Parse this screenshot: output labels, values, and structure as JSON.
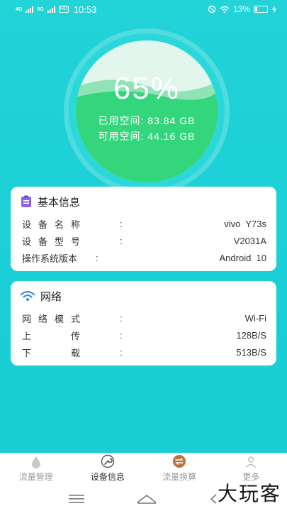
{
  "status_bar": {
    "time": "10:53",
    "signal1": "4G",
    "signal2": "5G",
    "hd": "HD",
    "battery": "13%"
  },
  "storage": {
    "percent": "65%",
    "used": "已用空间: 83.84 GB",
    "free": "可用空间: 44.16 GB",
    "used_fraction": 0.65
  },
  "basic_info": {
    "title": "基本信息",
    "rows": [
      {
        "label": "设备名称",
        "colon": ":",
        "value": "vivo  Y73s"
      },
      {
        "label": "设备型号",
        "colon": ":",
        "value": "V2031A"
      },
      {
        "label": "操作系统版本",
        "colon": ":",
        "value": "Android  10"
      }
    ]
  },
  "network": {
    "title": "网络",
    "rows": [
      {
        "label": "网络模式",
        "colon": ":",
        "value": "Wi-Fi"
      },
      {
        "label": "上传",
        "colon": ":",
        "value": "128B/S"
      },
      {
        "label": "下载",
        "colon": ":",
        "value": "513B/S"
      }
    ]
  },
  "tabs": [
    {
      "label": "流量管理",
      "icon": "drop-icon",
      "active": false
    },
    {
      "label": "设备信息",
      "icon": "wrench-icon",
      "active": true
    },
    {
      "label": "流量换算",
      "icon": "exchange-icon",
      "active": false
    },
    {
      "label": "更多",
      "icon": "person-icon",
      "active": false
    }
  ],
  "watermark": "大玩客",
  "colors": {
    "background": "#1bcfd6",
    "gauge_fill": "#34d67c",
    "card": "#ffffff",
    "wifi_icon": "#3b8ee8",
    "clipboard_icon": "#8a63e6"
  }
}
